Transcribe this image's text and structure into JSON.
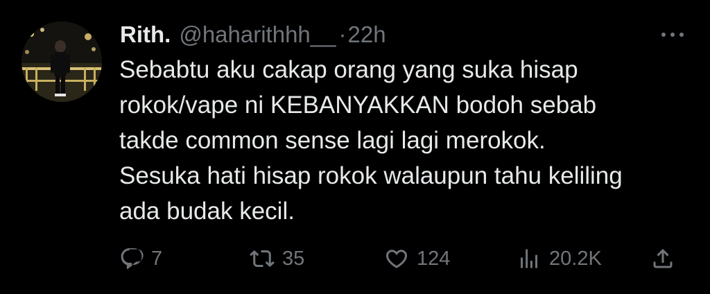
{
  "tweet": {
    "display_name": "Rith.",
    "handle": "@haharithhh__",
    "separator": "·",
    "time": "22h",
    "text_lines": [
      "Sebabtu aku cakap orang yang suka hisap",
      "rokok/vape ni KEBANYAKKAN bodoh sebab",
      "takde common sense lagi lagi merokok.",
      "Sesuka hati hisap rokok walaupun tahu keliling",
      "ada budak kecil."
    ]
  },
  "actions": {
    "reply": {
      "icon": "reply-icon",
      "count": "7"
    },
    "retweet": {
      "icon": "retweet-icon",
      "count": "35"
    },
    "like": {
      "icon": "heart-icon",
      "count": "124"
    },
    "views": {
      "icon": "views-chart-icon",
      "count": "20.2K"
    },
    "share": {
      "icon": "share-icon"
    }
  },
  "colors": {
    "background": "#000000",
    "text_primary": "#e7e9ea",
    "text_secondary": "#71767b"
  }
}
